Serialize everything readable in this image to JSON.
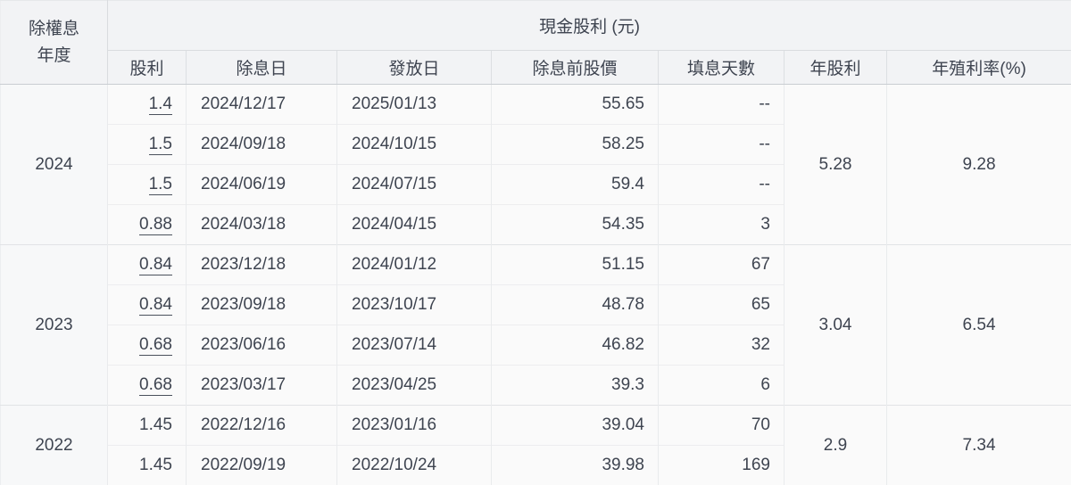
{
  "table": {
    "year_header": {
      "line1": "除權息",
      "line2": "年度"
    },
    "group_header": "現金股利 (元)",
    "columns": {
      "dividend": "股利",
      "ex_date": "除息日",
      "pay_date": "發放日",
      "pre_ex_price": "除息前股價",
      "fill_days": "填息天數",
      "annual_dividend": "年股利",
      "annual_yield": "年殖利率(%)"
    },
    "groups": [
      {
        "year": "2024",
        "annual_dividend": "5.28",
        "annual_yield": "9.28",
        "rows": [
          {
            "dividend": "1.4",
            "ex_date": "2024/12/17",
            "pay_date": "2025/01/13",
            "pre_ex_price": "55.65",
            "fill_days": "--"
          },
          {
            "dividend": "1.5",
            "ex_date": "2024/09/18",
            "pay_date": "2024/10/15",
            "pre_ex_price": "58.25",
            "fill_days": "--"
          },
          {
            "dividend": "1.5",
            "ex_date": "2024/06/19",
            "pay_date": "2024/07/15",
            "pre_ex_price": "59.4",
            "fill_days": "--"
          },
          {
            "dividend": "0.88",
            "ex_date": "2024/03/18",
            "pay_date": "2024/04/15",
            "pre_ex_price": "54.35",
            "fill_days": "3"
          }
        ]
      },
      {
        "year": "2023",
        "annual_dividend": "3.04",
        "annual_yield": "6.54",
        "rows": [
          {
            "dividend": "0.84",
            "ex_date": "2023/12/18",
            "pay_date": "2024/01/12",
            "pre_ex_price": "51.15",
            "fill_days": "67"
          },
          {
            "dividend": "0.84",
            "ex_date": "2023/09/18",
            "pay_date": "2023/10/17",
            "pre_ex_price": "48.78",
            "fill_days": "65"
          },
          {
            "dividend": "0.68",
            "ex_date": "2023/06/16",
            "pay_date": "2023/07/14",
            "pre_ex_price": "46.82",
            "fill_days": "32"
          },
          {
            "dividend": "0.68",
            "ex_date": "2023/03/17",
            "pay_date": "2023/04/25",
            "pre_ex_price": "39.3",
            "fill_days": "6"
          }
        ]
      },
      {
        "year": "2022",
        "annual_dividend": "2.9",
        "annual_yield": "7.34",
        "rows": [
          {
            "dividend": "1.45",
            "ex_date": "2022/12/16",
            "pay_date": "2023/01/16",
            "pre_ex_price": "39.04",
            "fill_days": "70"
          },
          {
            "dividend": "1.45",
            "ex_date": "2022/09/19",
            "pay_date": "2022/10/24",
            "pre_ex_price": "39.98",
            "fill_days": "169"
          }
        ]
      }
    ],
    "colors": {
      "header_bg": "#f2f3f5",
      "body_bg": "#fafafa",
      "text": "#3e4450",
      "strong_border": "#c9cdd2",
      "light_border": "#ededef"
    }
  }
}
